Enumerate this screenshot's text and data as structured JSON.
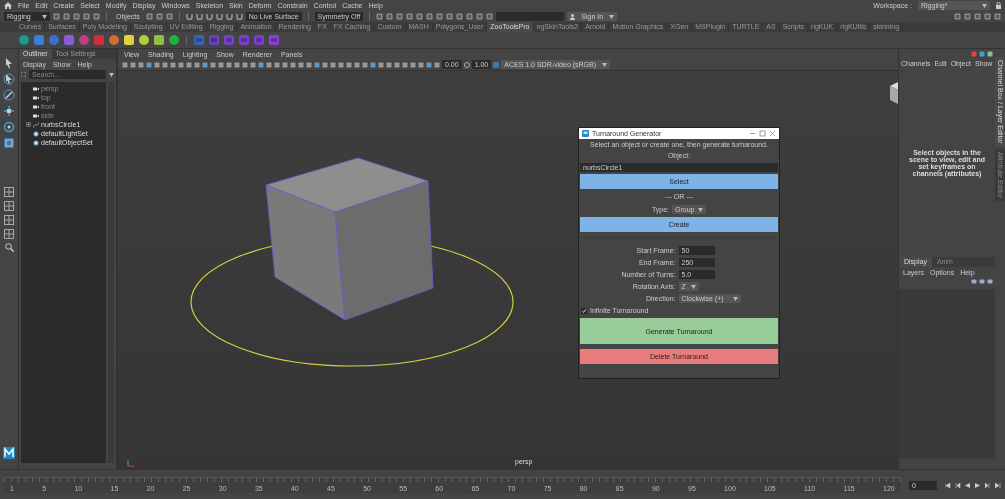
{
  "menu_bar": {
    "items": [
      "File",
      "Edit",
      "Create",
      "Select",
      "Modify",
      "Display",
      "Windows",
      "Skeleton",
      "Skin",
      "Deform",
      "Constrain",
      "Control",
      "Cache",
      "Help"
    ],
    "workspace_label": "Workspace :",
    "workspace": "Rigging*"
  },
  "status_line": {
    "mode": "Rigging",
    "objects": "Objects",
    "live_surface": "No Live Surface",
    "symmetry": "Symmetry Off",
    "sign_in": "Sign In"
  },
  "shelf_tabs": [
    {
      "label": "Curves",
      "selected": false
    },
    {
      "label": "Surfaces",
      "selected": false
    },
    {
      "label": "Poly Modeling",
      "selected": false
    },
    {
      "label": "Sculpting",
      "selected": false
    },
    {
      "label": "UV Editing",
      "selected": false
    },
    {
      "label": "Rigging",
      "selected": false
    },
    {
      "label": "Animation",
      "selected": false
    },
    {
      "label": "Rendering",
      "selected": false
    },
    {
      "label": "FX",
      "selected": false
    },
    {
      "label": "FX Caching",
      "selected": false
    },
    {
      "label": "Custom",
      "selected": false
    },
    {
      "label": "MASH",
      "selected": false
    },
    {
      "label": "Polygons_User",
      "selected": false
    },
    {
      "label": "ZooToolsPro",
      "selected": true
    },
    {
      "label": "ngSkinTools2",
      "selected": false
    },
    {
      "label": "Arnold",
      "selected": false
    },
    {
      "label": "Motion Graphics",
      "selected": false
    },
    {
      "label": "XGen",
      "selected": false
    },
    {
      "label": "MSPlugin",
      "selected": false
    },
    {
      "label": "TURTLE",
      "selected": false
    },
    {
      "label": "AS",
      "selected": false
    },
    {
      "label": "Scripts",
      "selected": false
    },
    {
      "label": "rigKUK",
      "selected": false
    },
    {
      "label": "rigKUtils",
      "selected": false
    },
    {
      "label": "skinning",
      "selected": false
    }
  ],
  "outliner": {
    "tabs": [
      {
        "label": "Outliner",
        "selected": true
      },
      {
        "label": "Tool Settings",
        "selected": false
      }
    ],
    "menus": [
      "Display",
      "Show",
      "Help"
    ],
    "search_placeholder": "Search...",
    "items": [
      {
        "label": "persp",
        "kind": "camera",
        "hidden": true
      },
      {
        "label": "top",
        "kind": "camera",
        "hidden": true
      },
      {
        "label": "front",
        "kind": "camera",
        "hidden": true
      },
      {
        "label": "side",
        "kind": "camera",
        "hidden": true
      },
      {
        "label": "nurbsCircle1",
        "kind": "curve",
        "hidden": false,
        "expanded": false
      },
      {
        "label": "defaultLightSet",
        "kind": "set",
        "hidden": false
      },
      {
        "label": "defaultObjectSet",
        "kind": "set",
        "hidden": false
      }
    ]
  },
  "viewport": {
    "menus": [
      "View",
      "Shading",
      "Lighting",
      "Show",
      "Renderer",
      "Panels"
    ],
    "exposure": "0.00",
    "gamma": "1.00",
    "color_space": "ACES 1.0 SDR-video (sRGB)",
    "camera_label": "persp"
  },
  "dialog": {
    "title": "Turnaround Generator",
    "instruction": "Select an object or create one, then generate turnaround.",
    "object_label": "Object:",
    "object_value": "nurbsCircle1",
    "select_button": "Select",
    "or_label": "--- OR ---",
    "type_label": "Type:",
    "type_value": "Group",
    "create_button": "Create",
    "fields": [
      {
        "label": "Start Frame:",
        "value": "50",
        "kind": "input"
      },
      {
        "label": "End Frame:",
        "value": "250",
        "kind": "input"
      },
      {
        "label": "Number of Turns:",
        "value": "5.0",
        "kind": "input"
      },
      {
        "label": "Rotation Axis:",
        "value": "Z",
        "kind": "dropdown"
      },
      {
        "label": "Direction:",
        "value": "Clockwise (+)",
        "kind": "dropdown"
      }
    ],
    "infinite": {
      "label": "Infinite Turnaround",
      "checked": true
    },
    "generate_button": "Generate Turnaround",
    "delete_button": "Delete Turnaround"
  },
  "channel_box": {
    "menus": [
      "Channels",
      "Edit",
      "Object",
      "Show"
    ],
    "message": "Select objects in the scene to view, edit and set keyframes on channels (attributes)",
    "side_tabs": [
      {
        "label": "Channel Box / Layer Editor",
        "selected": true
      },
      {
        "label": "Attribute Editor",
        "selected": false
      }
    ],
    "layer_tabs": [
      {
        "label": "Display",
        "selected": true
      },
      {
        "label": "Anim",
        "selected": false
      }
    ],
    "layer_menus": [
      "Layers",
      "Options",
      "Help"
    ]
  },
  "timeline": {
    "ticks": [
      "1",
      "5",
      "10",
      "15",
      "20",
      "25",
      "30",
      "35",
      "40",
      "45",
      "50",
      "55",
      "60",
      "65",
      "70",
      "75",
      "80",
      "85",
      "90",
      "95",
      "100",
      "105",
      "110",
      "115",
      "120"
    ],
    "current_frame": "0"
  }
}
